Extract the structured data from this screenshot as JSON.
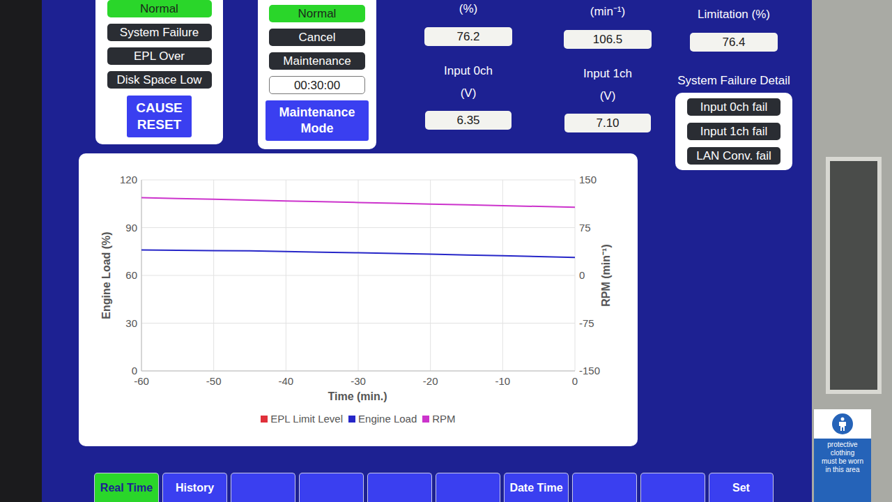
{
  "cause": {
    "items": [
      {
        "label": "Normal",
        "active": true
      },
      {
        "label": "System Failure",
        "active": false
      },
      {
        "label": "EPL Over",
        "active": false
      },
      {
        "label": "Disk Space Low",
        "active": false
      }
    ],
    "reset": "CAUSE RESET"
  },
  "maintenance": {
    "items": [
      {
        "label": "Normal",
        "active": true
      },
      {
        "label": "Cancel",
        "active": false
      },
      {
        "label": "Maintenance",
        "active": false
      }
    ],
    "timer": "00:30:00",
    "button": "Maintenance Mode"
  },
  "readings": [
    {
      "unit": "(%)",
      "value": "76.2"
    },
    {
      "unit": "(min⁻¹)",
      "value": "106.5"
    },
    {
      "unit": "Limitation (%)",
      "value": "76.4"
    }
  ],
  "inputs": [
    {
      "label": "Input 0ch",
      "unit": "(V)",
      "value": "6.35"
    },
    {
      "label": "Input 1ch",
      "unit": "(V)",
      "value": "7.10"
    }
  ],
  "failure_detail": {
    "title": "System Failure Detail",
    "items": [
      {
        "label": "Input 0ch fail",
        "active": false
      },
      {
        "label": "Input 1ch fail",
        "active": false
      },
      {
        "label": "LAN Conv. fail",
        "active": false
      }
    ]
  },
  "chart": {
    "left_title": "Engine Load (%)",
    "right_title": "RPM (min⁻¹)",
    "x_title": "Time (min.)",
    "x_ticks": [
      "-60",
      "-50",
      "-40",
      "-30",
      "-20",
      "-10",
      "0"
    ],
    "left_ticks": [
      "0",
      "30",
      "60",
      "90",
      "120"
    ],
    "right_ticks": [
      "-150",
      "-75",
      "0",
      "75",
      "150"
    ],
    "series": [
      {
        "name": "EPL Limit Level",
        "color": "#e0303a",
        "axis": "left",
        "values": []
      },
      {
        "name": "Engine Load",
        "color": "#2626c8",
        "axis": "left",
        "values": [
          76,
          75.8,
          75.5,
          75.4,
          75,
          74.6,
          74.2,
          73.8,
          73.4,
          72.8,
          72.4,
          71.8,
          71.3
        ]
      },
      {
        "name": "RPM",
        "color": "#cc33cc",
        "axis": "right",
        "values": [
          122,
          120.8,
          119.5,
          118.3,
          117,
          115.8,
          114.5,
          113.3,
          112,
          110.8,
          109.5,
          108.3,
          107
        ]
      }
    ]
  },
  "tabs": [
    {
      "label": "Real Time",
      "selected": true
    },
    {
      "label": "History",
      "selected": false
    },
    {
      "label": "",
      "selected": false
    },
    {
      "label": "",
      "selected": false
    },
    {
      "label": "",
      "selected": false
    },
    {
      "label": "",
      "selected": false
    },
    {
      "label": "Date Time",
      "selected": false
    },
    {
      "label": "",
      "selected": false
    },
    {
      "label": "",
      "selected": false
    },
    {
      "label": "Set",
      "selected": false
    }
  ],
  "sign": {
    "lines": [
      "protective",
      "clothing",
      "must be worn",
      "in this area"
    ]
  }
}
